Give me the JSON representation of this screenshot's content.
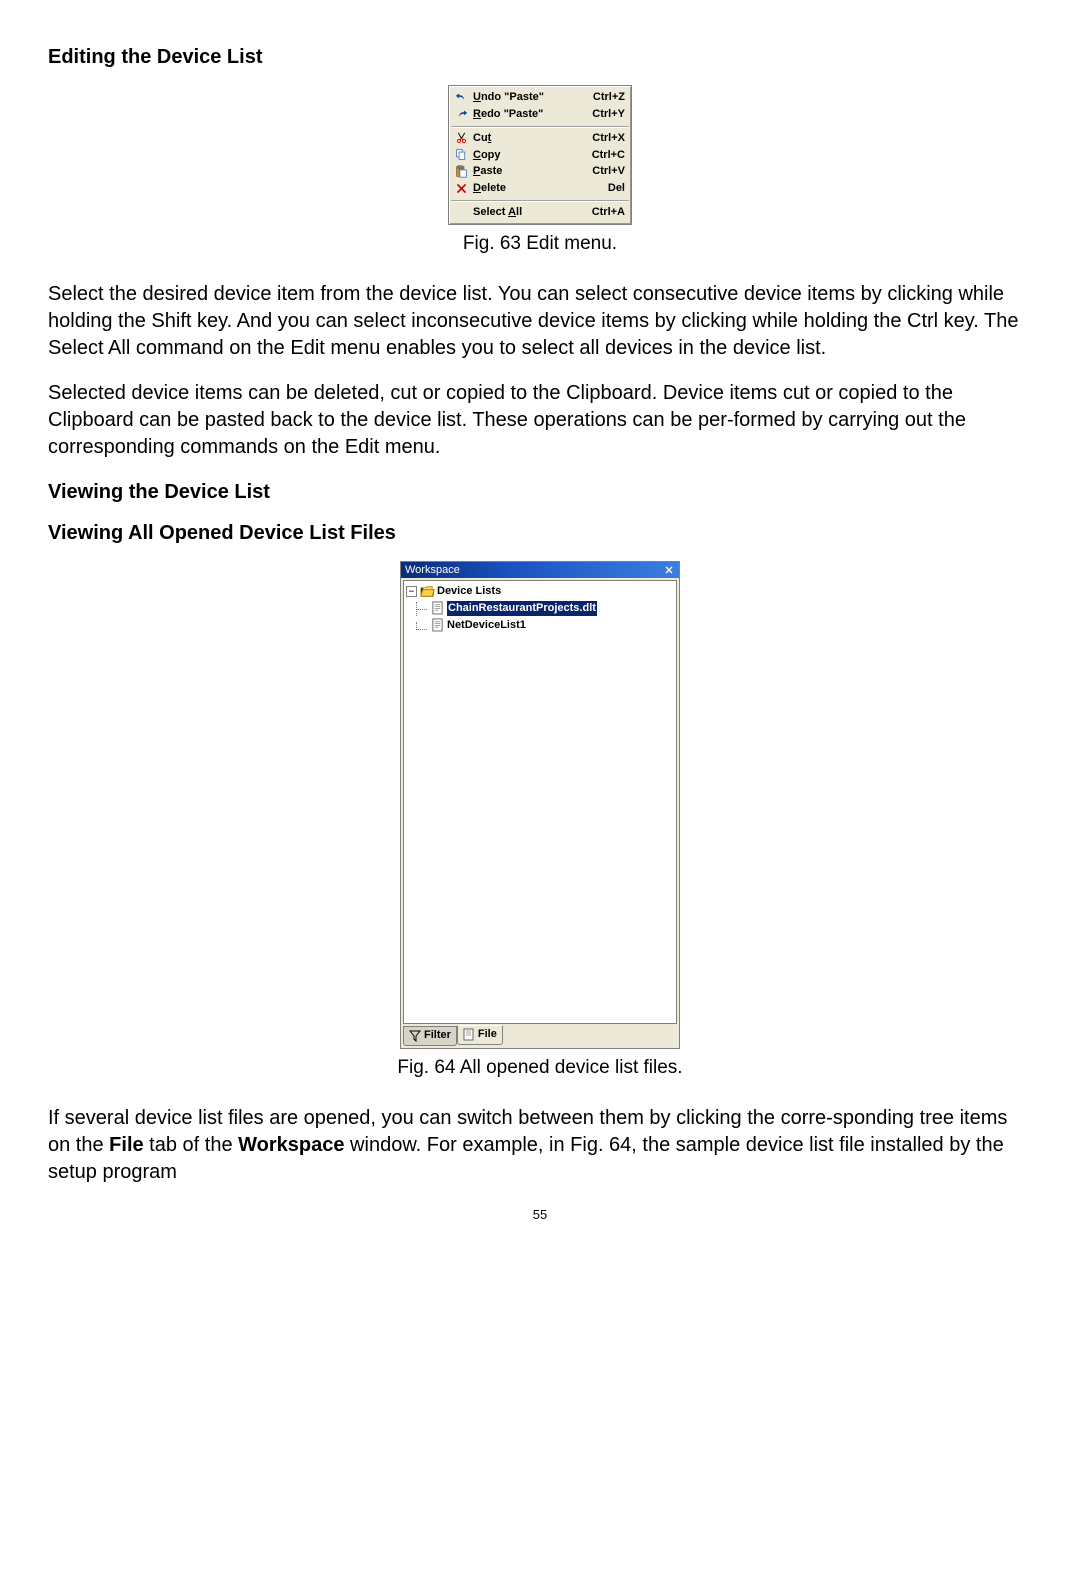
{
  "headings": {
    "editing": "Editing the Device List",
    "viewing": "Viewing the Device List",
    "viewing_all": "Viewing All Opened Device List Files"
  },
  "fig63": {
    "caption": "Fig. 63 Edit menu.",
    "items": {
      "undo": {
        "label_pre": "",
        "underline": "U",
        "label_post": "ndo \"Paste\"",
        "shortcut": "Ctrl+Z"
      },
      "redo": {
        "label_pre": "",
        "underline": "R",
        "label_post": "edo \"Paste\"",
        "shortcut": "Ctrl+Y"
      },
      "cut": {
        "label_pre": "Cu",
        "underline": "t",
        "label_post": "",
        "shortcut": "Ctrl+X"
      },
      "copy": {
        "label_pre": "",
        "underline": "C",
        "label_post": "opy",
        "shortcut": "Ctrl+C"
      },
      "paste": {
        "label_pre": "",
        "underline": "P",
        "label_post": "aste",
        "shortcut": "Ctrl+V"
      },
      "delete": {
        "label_pre": "",
        "underline": "D",
        "label_post": "elete",
        "shortcut": "Del"
      },
      "selectall": {
        "label_pre": "Select ",
        "underline": "A",
        "label_post": "ll",
        "shortcut": "Ctrl+A"
      }
    }
  },
  "paragraphs": {
    "p1": "Select the desired device item from the device list. You can select consecutive device items by clicking while holding the Shift key. And you can select inconsecutive device items by clicking while holding the Ctrl key. The Select All command on the Edit menu enables you to select all devices in the device list.",
    "p2": "Selected device items can be deleted, cut or copied to the Clipboard. Device items cut or copied to the Clipboard can be pasted back to the device list. These operations can be per-formed by carrying out the corresponding commands on the Edit menu."
  },
  "fig64": {
    "title": "Workspace",
    "root_label": "Device Lists",
    "item1": "ChainRestaurantProjects.dlt",
    "item2": "NetDeviceList1",
    "tab_filter": "Filter",
    "tab_file": "File",
    "caption": "Fig. 64 All opened device list files."
  },
  "paragraph3": {
    "prefix": "If several device list files are opened, you can switch between them by clicking the corre-sponding tree items on the ",
    "bold1": "File",
    "mid1": " tab of the ",
    "bold2": "Workspace",
    "suffix": " window. For example, in Fig. 64, the sample device list file installed by the setup program"
  },
  "page_number": "55"
}
